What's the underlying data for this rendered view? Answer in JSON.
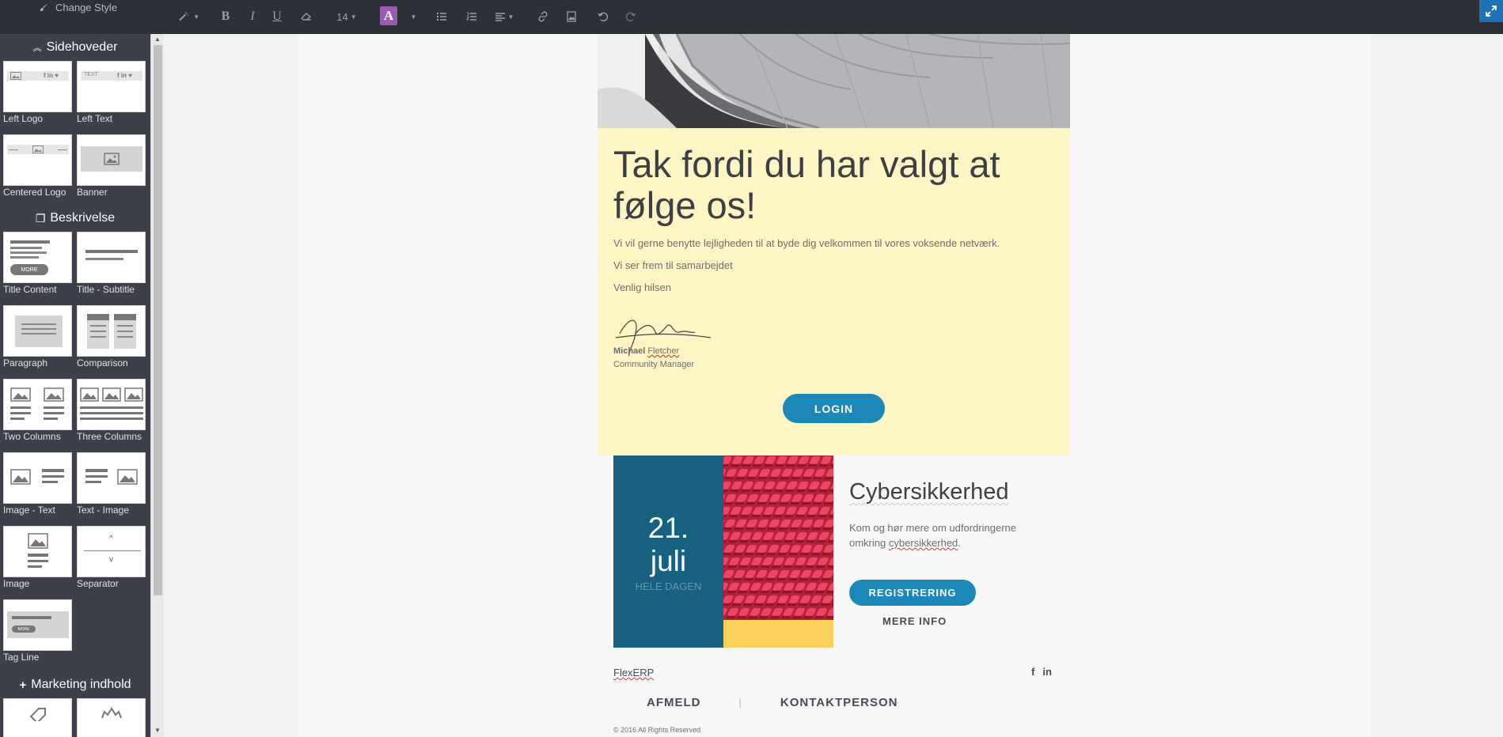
{
  "toolbar": {
    "change_style_label": "Change Style",
    "font_size": "14",
    "bold": "B",
    "italic": "I",
    "underline": "U",
    "text_color": "A",
    "accent_color": "#9b59b6"
  },
  "sidebar": {
    "sections": [
      {
        "title": "Sidehoveder",
        "items": [
          {
            "label": "Left Logo"
          },
          {
            "label": "Left Text"
          },
          {
            "label": "Centered Logo"
          },
          {
            "label": "Banner"
          }
        ]
      },
      {
        "title": "Beskrivelse",
        "items": [
          {
            "label": "Title Content"
          },
          {
            "label": "Title - Subtitle"
          },
          {
            "label": "Paragraph"
          },
          {
            "label": "Comparison"
          },
          {
            "label": "Two Columns"
          },
          {
            "label": "Three Columns"
          },
          {
            "label": "Image - Text"
          },
          {
            "label": "Text - Image"
          },
          {
            "label": "Image"
          },
          {
            "label": "Separator"
          },
          {
            "label": "Tag Line"
          }
        ]
      },
      {
        "title": "Marketing indhold",
        "items": []
      }
    ],
    "thumb_texts": {
      "more": "MORE",
      "text": "TEXT"
    }
  },
  "email": {
    "headline": "Tak fordi du har valgt at følge os!",
    "paragraphs": [
      "Vi vil gerne benytte lejligheden til at byde dig velkommen til vores voksende netværk.",
      "Vi ser frem til samarbejdet",
      "Venlig hilsen"
    ],
    "signature": {
      "first_name": "Michael",
      "last_name": "Fletcher",
      "role": "Community Manager"
    },
    "login_button": "LOGIN",
    "event": {
      "day": "21.",
      "month": "juli",
      "subtitle": "HELE DAGEN",
      "title": "Cybersikkerhed",
      "desc_prefix": "Kom og hør mere om udfordringerne omkring ",
      "desc_link": "cybersikkerhed",
      "desc_suffix": ".",
      "register_button": "REGISTRERING",
      "more_info": "MERE INFO"
    },
    "footer": {
      "brand": "FlexERP",
      "unsubscribe": "AFMELD",
      "contact": "KONTAKTPERSON",
      "separator": "|",
      "copyright": "© 2016 All Rights Reserved"
    }
  }
}
